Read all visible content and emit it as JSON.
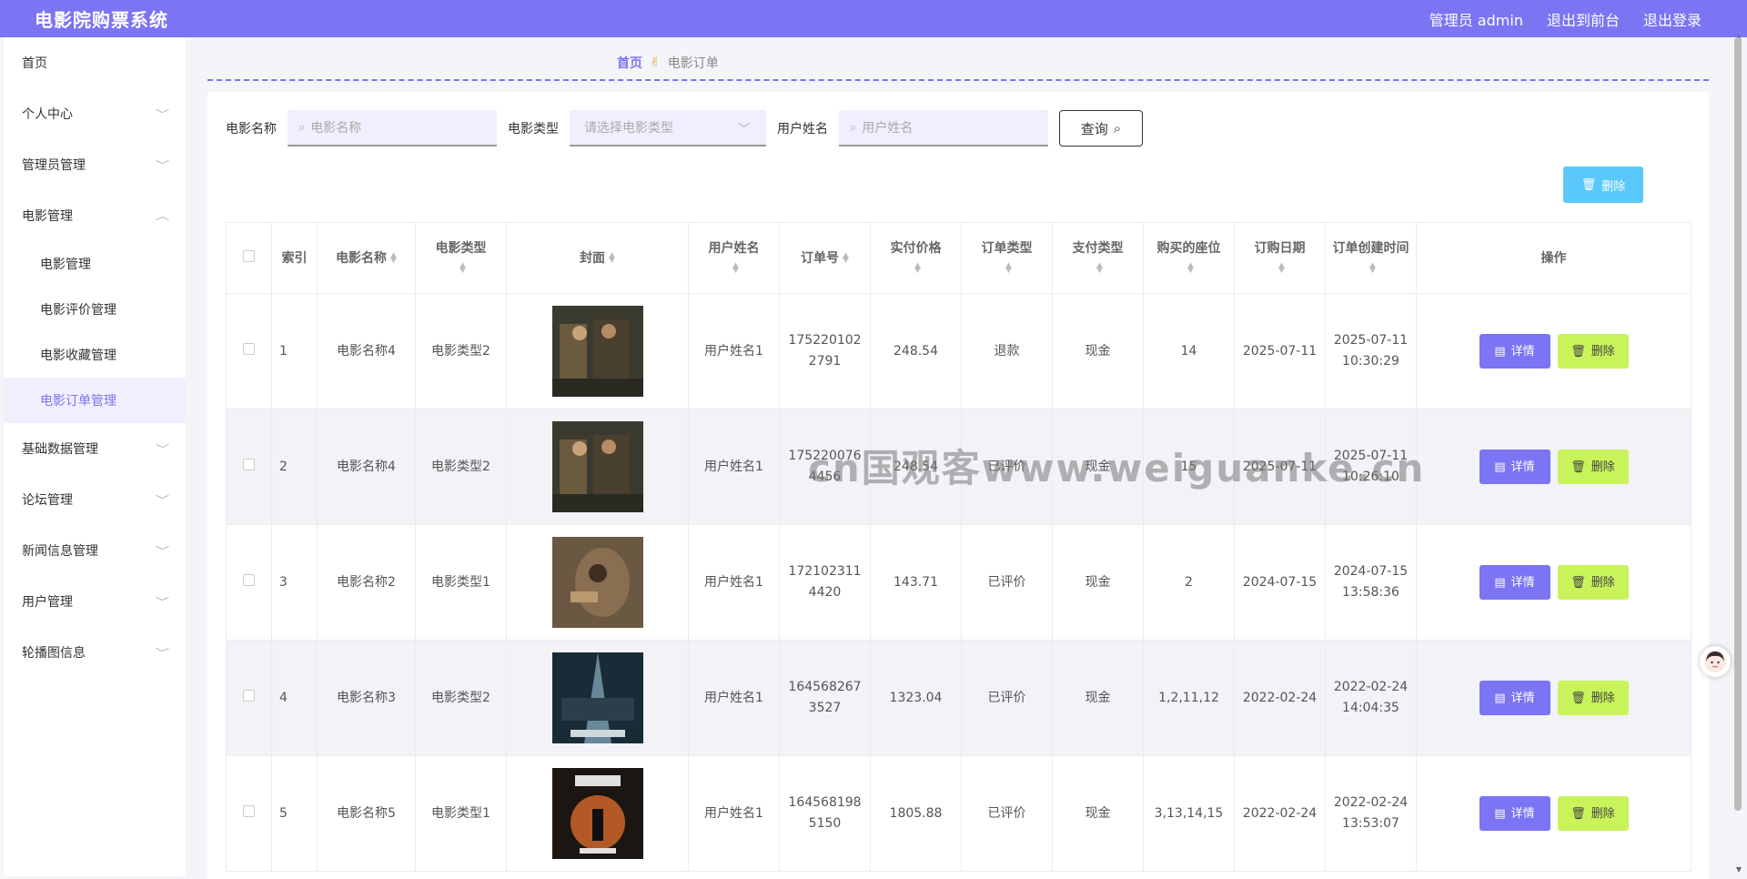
{
  "header": {
    "brand": "电影院购票系统",
    "admin_label": "管理员 admin",
    "front_label": "退出到前台",
    "logout_label": "退出登录"
  },
  "sidebar": {
    "items": [
      {
        "label": "首页"
      },
      {
        "label": "个人中心"
      },
      {
        "label": "管理员管理"
      },
      {
        "label": "电影管理"
      },
      {
        "label": "基础数据管理"
      },
      {
        "label": "论坛管理"
      },
      {
        "label": "新闻信息管理"
      },
      {
        "label": "用户管理"
      },
      {
        "label": "轮播图信息"
      }
    ],
    "sub_items": [
      {
        "label": "电影管理"
      },
      {
        "label": "电影评价管理"
      },
      {
        "label": "电影收藏管理"
      },
      {
        "label": "电影订单管理"
      }
    ]
  },
  "breadcrumb": {
    "home": "首页",
    "current": "电影订单"
  },
  "filters": {
    "movie_name_label": "电影名称",
    "movie_name_placeholder": "电影名称",
    "movie_type_label": "电影类型",
    "movie_type_placeholder": "请选择电影类型",
    "user_name_label": "用户姓名",
    "user_name_placeholder": "用户姓名",
    "query_label": "查询"
  },
  "actions": {
    "delete_label": "删除",
    "detail_label": "详情"
  },
  "table": {
    "headers": [
      "索引",
      "电影名称",
      "电影类型",
      "封面",
      "用户姓名",
      "订单号",
      "实付价格",
      "订单类型",
      "支付类型",
      "购买的座位",
      "订购日期",
      "订单创建时间",
      "操作"
    ],
    "rows": [
      {
        "index": "1",
        "movie": "电影名称4",
        "type": "电影类型2",
        "user": "用户姓名1",
        "order_no_a": "175220102",
        "order_no_b": "2791",
        "price": "248.54",
        "order_type": "退款",
        "pay_type": "现金",
        "seats": "14",
        "date": "2025-07-11",
        "created_a": "2025-07-11",
        "created_b": "10:30:29"
      },
      {
        "index": "2",
        "movie": "电影名称4",
        "type": "电影类型2",
        "user": "用户姓名1",
        "order_no_a": "175220076",
        "order_no_b": "4456",
        "price": "248.54",
        "order_type": "已评价",
        "pay_type": "现金",
        "seats": "15",
        "date": "2025-07-11",
        "created_a": "2025-07-11",
        "created_b": "10:26:10"
      },
      {
        "index": "3",
        "movie": "电影名称2",
        "type": "电影类型1",
        "user": "用户姓名1",
        "order_no_a": "172102311",
        "order_no_b": "4420",
        "price": "143.71",
        "order_type": "已评价",
        "pay_type": "现金",
        "seats": "2",
        "date": "2024-07-15",
        "created_a": "2024-07-15",
        "created_b": "13:58:36"
      },
      {
        "index": "4",
        "movie": "电影名称3",
        "type": "电影类型2",
        "user": "用户姓名1",
        "order_no_a": "164568267",
        "order_no_b": "3527",
        "price": "1323.04",
        "order_type": "已评价",
        "pay_type": "现金",
        "seats": "1,2,11,12",
        "date": "2022-02-24",
        "created_a": "2022-02-24",
        "created_b": "14:04:35"
      },
      {
        "index": "5",
        "movie": "电影名称5",
        "type": "电影类型1",
        "user": "用户姓名1",
        "order_no_a": "164568198",
        "order_no_b": "5150",
        "price": "1805.88",
        "order_type": "已评价",
        "pay_type": "现金",
        "seats": "3,13,14,15",
        "date": "2022-02-24",
        "created_a": "2022-02-24",
        "created_b": "13:53:07"
      }
    ]
  },
  "watermark": "cn国观客www.weiguanke.cn",
  "colors": {
    "primary": "#7b74f3",
    "delete_top": "#5ac8fa",
    "delete_row": "#c8f35a"
  }
}
